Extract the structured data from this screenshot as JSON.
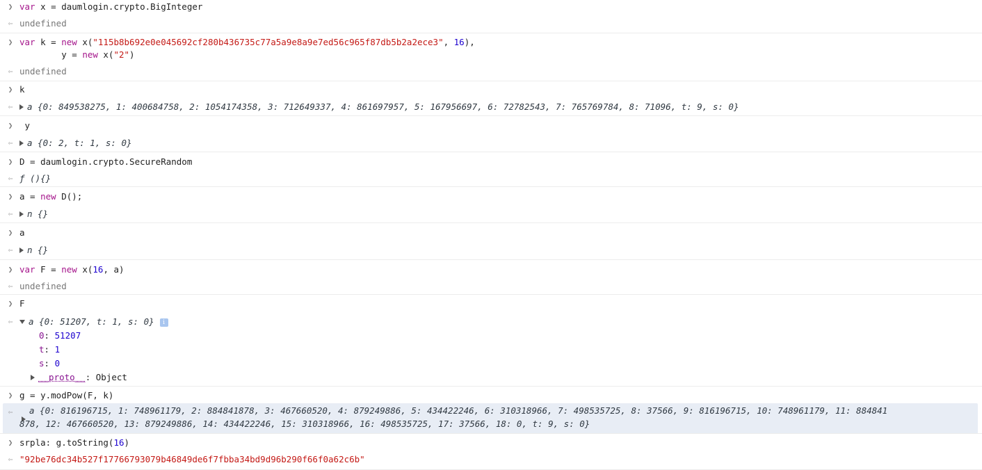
{
  "entries": [
    {
      "input": "var x = daumlogin.crypto.BigInteger",
      "output": "undefined"
    },
    {
      "input_line1_a": "var k = new x(",
      "input_line1_str": "\"115b8b692e0e045692cf280b436735c77a5a9e8a9e7ed56c965f87db5b2a2ece3\"",
      "input_line1_b": ", ",
      "input_line1_num": "16",
      "input_line1_c": "),",
      "input_line2_a": "        y = new x(",
      "input_line2_str": "\"2\"",
      "input_line2_c": ")",
      "output": "undefined"
    },
    {
      "input": "k",
      "output": "a {0: 849538275, 1: 400684758, 2: 1054174358, 3: 712649337, 4: 861697957, 5: 167956697, 6: 72782543, 7: 765769784, 8: 71096, t: 9, s: 0}"
    },
    {
      "input": " y",
      "output": "a {0: 2, t: 1, s: 0}"
    },
    {
      "input": "D = daumlogin.crypto.SecureRandom",
      "output": "ƒ (){}"
    },
    {
      "input": "a = new D();",
      "output": "n {}"
    },
    {
      "input": "a",
      "output": "n {}"
    },
    {
      "input": "var F = new x(16, a)",
      "output": "undefined"
    },
    {
      "input": "F",
      "output": "a {0: 51207, t: 1, s: 0}",
      "children": [
        "0: 51207",
        "t: 1",
        "s: 0"
      ],
      "proto": "__proto__: Object"
    },
    {
      "input": "g = y.modPow(F, k)",
      "output_line1": "a {0: 816196715, 1: 748961179, 2: 884841878, 3: 467660520, 4: 879249886, 5: 434422246, 6: 310318966, 7: 498535725, 8: 37566, 9: 816196715, 10: 748961179, 11: 884841",
      "output_line2": "878, 12: 467660520, 13: 879249886, 14: 434422246, 15: 310318966, 16: 498535725, 17: 37566, 18: 0, t: 9, s: 0}"
    },
    {
      "input": "srpla: g.toString(16)",
      "output": "\"92be76dc34b527f17766793079b46849de6f7fbba34bd9d96b290f66f0a62c6b\""
    }
  ],
  "info_badge": "i",
  "icons": {
    "input_prompt": "chevron-right-icon",
    "output_prompt": "return-arrow-icon",
    "expand": "triangle-expand-icon",
    "collapse": "triangle-collapse-icon"
  }
}
